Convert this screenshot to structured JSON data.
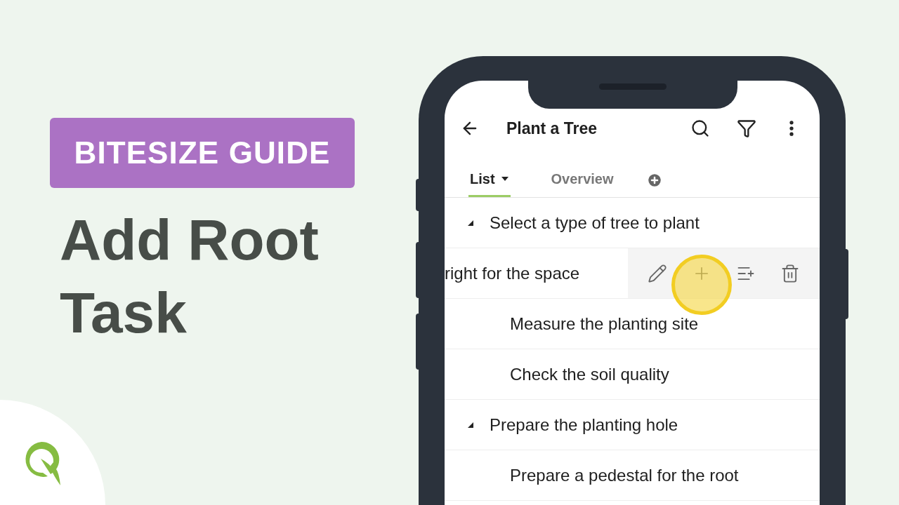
{
  "badge": "BITESIZE GUIDE",
  "heading": "Add Root Task",
  "app": {
    "title": "Plant a Tree",
    "tabs": [
      {
        "label": "List",
        "selected": true,
        "dropdown": true
      },
      {
        "label": "Overview",
        "selected": false,
        "dropdown": false
      }
    ],
    "tasks": [
      {
        "title": "Select a type of tree to plant",
        "expanded": true,
        "children": [
          {
            "title": "right for the space",
            "swiped": true
          },
          {
            "title": "Measure the planting site",
            "swiped": false
          },
          {
            "title": "Check the soil quality",
            "swiped": false
          }
        ]
      },
      {
        "title": "Prepare the planting hole",
        "expanded": true,
        "children": [
          {
            "title": "Prepare a pedestal for the root",
            "swiped": false
          }
        ]
      }
    ],
    "row_actions": [
      {
        "kind": "edit",
        "highlighted": false
      },
      {
        "kind": "add",
        "highlighted": true
      },
      {
        "kind": "add-subtask",
        "highlighted": false
      },
      {
        "kind": "delete",
        "highlighted": false
      }
    ]
  }
}
